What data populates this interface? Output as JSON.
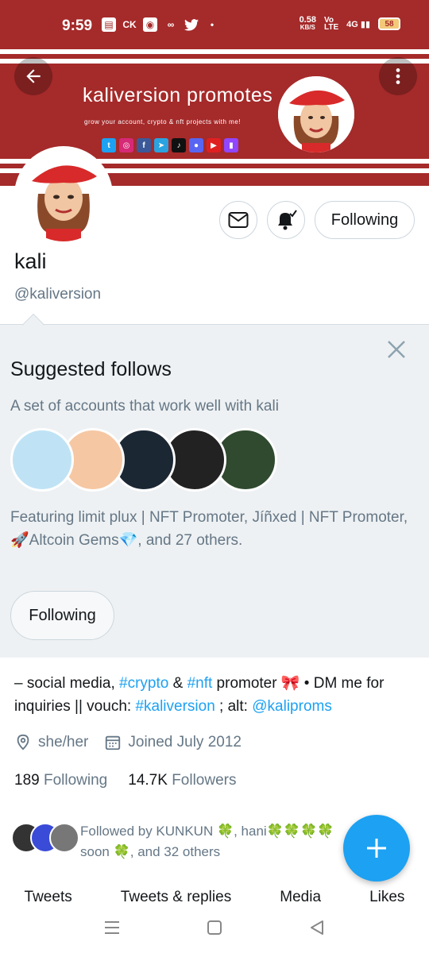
{
  "status_bar": {
    "time": "9:59",
    "icons": [
      "message-icon",
      "CK",
      "signal-app-icon",
      "ampersand-icon",
      "twitter-icon",
      "dot-icon"
    ],
    "speed_top": "0.58",
    "speed_bottom": "KB/S",
    "network": "4G",
    "battery": "58"
  },
  "banner": {
    "title": "kaliversion promotes",
    "subtitle": "grow your account, crypto & nft projects with me!",
    "social": [
      {
        "icon": "twitter-icon",
        "color": "#1da1f2",
        "glyph": "t"
      },
      {
        "icon": "instagram-icon",
        "color": "#d62976",
        "glyph": "◎"
      },
      {
        "icon": "facebook-icon",
        "color": "#3b5998",
        "glyph": "f"
      },
      {
        "icon": "telegram-icon",
        "color": "#2aa3e0",
        "glyph": "➤"
      },
      {
        "icon": "tiktok-icon",
        "color": "#111111",
        "glyph": "♪"
      },
      {
        "icon": "discord-icon",
        "color": "#5865f2",
        "glyph": "●"
      },
      {
        "icon": "youtube-icon",
        "color": "#e02020",
        "glyph": "▶"
      },
      {
        "icon": "twitch-icon",
        "color": "#9146ff",
        "glyph": "▮"
      }
    ]
  },
  "profile": {
    "follow_label": "Following",
    "name": "kali",
    "handle": "@kaliversion"
  },
  "suggested": {
    "title": "Suggested follows",
    "description": "A set of accounts that work well with kali",
    "featuring": "Featuring limit plux | NFT Promoter, Jíñxed | NFT Promoter, 🚀Altcoin Gems💎, and 27 others.",
    "follow_label": "Following",
    "avatar_colors": [
      "#bfe3f5",
      "#f6c7a3",
      "#1b2733",
      "#222222",
      "#2f4a2f"
    ]
  },
  "bio": {
    "prefix": "– social media, ",
    "tag1": "#crypto",
    "amp": " & ",
    "tag2": "#nft",
    "middle": " promoter 🎀 • DM me for inquiries || vouch: ",
    "tag3": "#kaliversion",
    "alt_label": " ; alt: ",
    "mention": "@kaliproms"
  },
  "meta": {
    "pronouns": "she/her",
    "joined": "Joined July 2012"
  },
  "counts": {
    "following_num": "189",
    "following_label": "Following",
    "followers_num": "14.7K",
    "followers_label": "Followers"
  },
  "followed_by": {
    "text": "Followed by KUNKUN 🍀, hani🍀🍀🍀🍀 soon 🍀, and 32 others"
  },
  "tabs": [
    "Tweets",
    "Tweets & replies",
    "Media",
    "Likes"
  ],
  "colors": {
    "brand": "#1da1f2",
    "banner": "#a52a2a"
  }
}
